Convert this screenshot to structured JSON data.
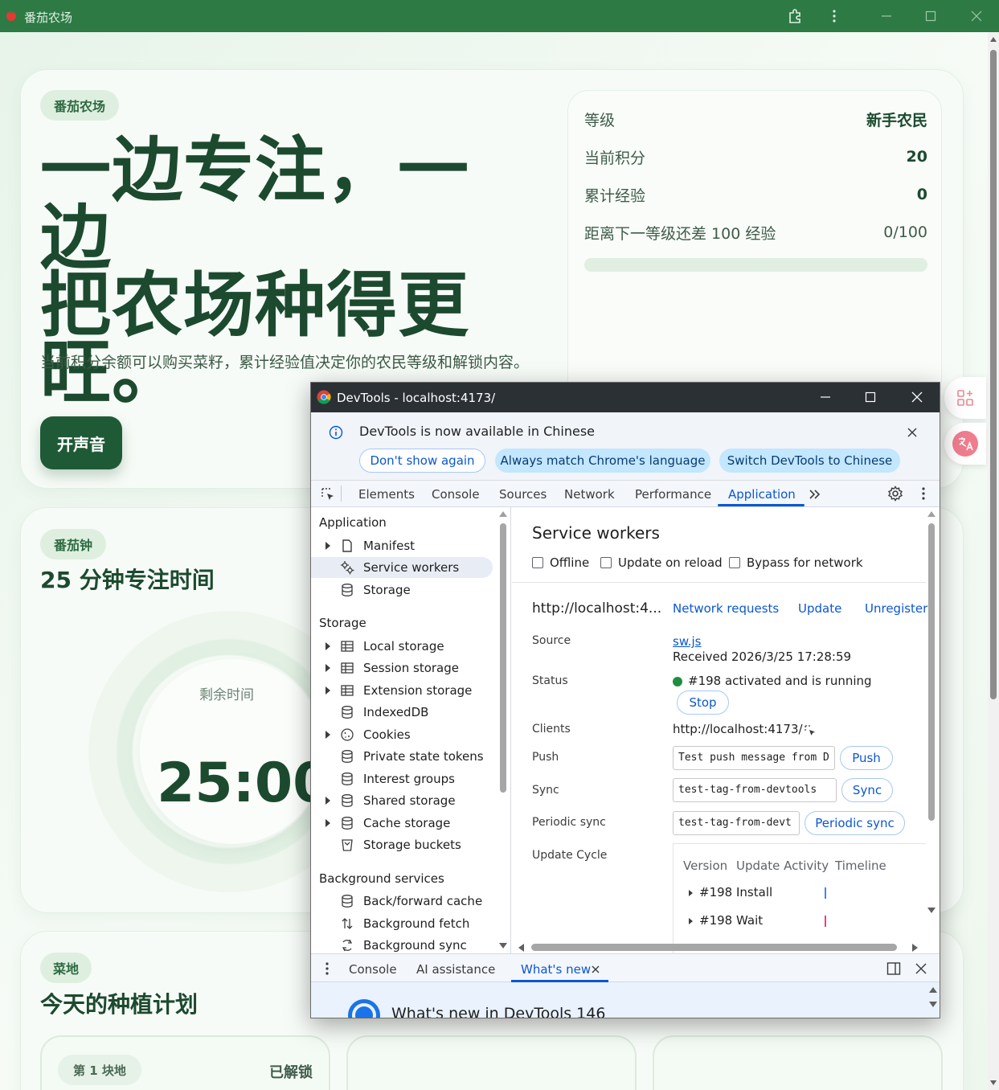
{
  "app": {
    "title": "番茄农场"
  },
  "hero": {
    "badge": "番茄农场",
    "headline_line1": "一边专注，一边",
    "headline_line2": "把农场种得更",
    "headline_line3": "旺。",
    "description": "当前积分余额可以购买菜籽，累计经验值决定你的农民等级和解锁内容。",
    "sound_button": "开声音"
  },
  "stats": {
    "level_label": "等级",
    "level_value": "新手农民",
    "points_label": "当前积分",
    "points_value": "20",
    "exp_label": "累计经验",
    "exp_value": "0",
    "next_label": "距离下一等级还差 100 经验",
    "next_value": "0/100",
    "progress_fraction": 0
  },
  "timer": {
    "badge": "番茄钟",
    "title": "25 分钟专注时间",
    "remaining_label": "剩余时间",
    "remaining_value": "25:00"
  },
  "garden": {
    "badge": "菜地",
    "title": "今天的种植计划",
    "plots": [
      {
        "name": "第 1 块地",
        "status": "已解锁"
      }
    ]
  },
  "devtools": {
    "window_title": "DevTools - localhost:4173/",
    "infobar": {
      "message": "DevTools is now available in Chinese",
      "btn_dont_show": "Don't show again",
      "btn_match": "Always match Chrome's language",
      "btn_switch": "Switch DevTools to Chinese"
    },
    "tabs": [
      "Elements",
      "Console",
      "Sources",
      "Network",
      "Performance",
      "Application"
    ],
    "active_tab": "Application",
    "sidebar": {
      "sections": [
        {
          "title": "Application",
          "items": [
            "Manifest",
            "Service workers",
            "Storage"
          ]
        },
        {
          "title": "Storage",
          "items": [
            "Local storage",
            "Session storage",
            "Extension storage",
            "IndexedDB",
            "Cookies",
            "Private state tokens",
            "Interest groups",
            "Shared storage",
            "Cache storage",
            "Storage buckets"
          ]
        },
        {
          "title": "Background services",
          "items": [
            "Back/forward cache",
            "Background fetch",
            "Background sync"
          ]
        }
      ],
      "selected": "Service workers"
    },
    "service_workers": {
      "title": "Service workers",
      "offline": "Offline",
      "update_on_reload": "Update on reload",
      "bypass": "Bypass for network",
      "origin": "http://localhost:4...",
      "link_network": "Network requests",
      "link_update": "Update",
      "link_unregister": "Unregister",
      "source_label": "Source",
      "source_file": "sw.js",
      "received": "Received 2026/3/25 17:28:59",
      "status_label": "Status",
      "status_value": "#198 activated and is running",
      "status_color": "#1e8e3e",
      "stop_btn": "Stop",
      "clients_label": "Clients",
      "clients_value": "http://localhost:4173/",
      "push_label": "Push",
      "push_value": "Test push message from D",
      "push_btn": "Push",
      "sync_label": "Sync",
      "sync_value": "test-tag-from-devtools",
      "sync_btn": "Sync",
      "periodic_label": "Periodic sync",
      "periodic_value": "test-tag-from-devt",
      "periodic_btn": "Periodic sync",
      "cycle_label": "Update Cycle",
      "cycle_cols": [
        "Version",
        "Update Activity",
        "Timeline"
      ],
      "cycle_rows": [
        {
          "version": "#198",
          "activity": "Install"
        },
        {
          "version": "#198",
          "activity": "Wait"
        }
      ]
    },
    "drawer": {
      "tabs": [
        "Console",
        "AI assistance",
        "What's new"
      ],
      "active": "What's new",
      "whats_new_title": "What's new in DevTools 146"
    }
  }
}
